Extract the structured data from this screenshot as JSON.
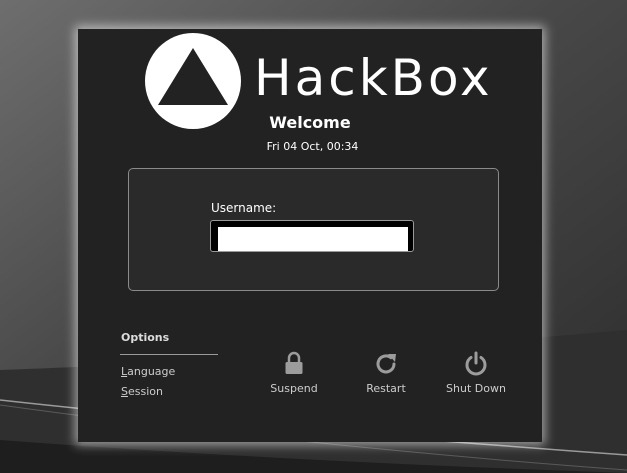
{
  "brand": {
    "name": "HackBox"
  },
  "greeting": {
    "title": "Welcome",
    "datetime": "Fri 04 Oct, 00:34"
  },
  "login": {
    "username_label": "Username:",
    "username_value": ""
  },
  "options": {
    "title": "Options",
    "items": [
      {
        "label": "Language",
        "mnemonic": "L"
      },
      {
        "label": "Session",
        "mnemonic": "S"
      }
    ]
  },
  "power": {
    "suspend": {
      "label": "Suspend",
      "icon": "lock-icon"
    },
    "restart": {
      "label": "Restart",
      "icon": "restart-icon"
    },
    "shutdown": {
      "label": "Shut Down",
      "icon": "power-icon"
    }
  },
  "colors": {
    "panel": "#222222",
    "background": "#3a3a3a",
    "text": "#ffffff",
    "muted_text": "#cccccc"
  }
}
